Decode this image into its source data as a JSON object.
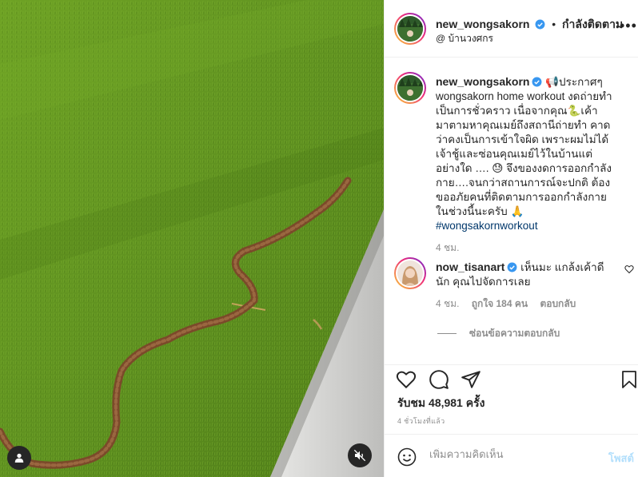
{
  "post": {
    "username": "new_wongsakorn",
    "follow_state": "กำลังติดตาม",
    "location": "บ้านวงศกร",
    "dot": "•"
  },
  "caption": {
    "username": "new_wongsakorn",
    "text": "📢ประกาศๆ wongsakorn home workout งดถ่ายทำเป็นการชั่วคราว เนื่อจากคุณ🐍เค้ามาตามหาคุณเมย์ถึงสถานีถ่ายทำ คาดว่าคงเป็นการเข้าใจผิด เพราะผมไม่ได้เจ้าชู้และซ่อนคุณเมย์ไว้ในบ้านแต่อย่างใด …. 😓 จึงของงดการออกกำลังกาย….จนกว่าสถานการณ์จะปกติ ต้องขออภัยคนที่ติดตามการออกกำลังกายในช่วงนี้นะครับ 🙏",
    "hashtag": "#wongsakornworkout",
    "time": "4 ชม."
  },
  "comment": {
    "username": "now_tisanart",
    "text": "เห็นมะ แกล้งเค้าดีนัก คุณไปจัดการเลย",
    "time": "4 ชม.",
    "likes": "ถูกใจ 184 คน",
    "reply": "ตอบกลับ",
    "hide_replies": "ซ่อนข้อความตอบกลับ"
  },
  "stats": {
    "views": "รับชม 48,981 ครั้ง",
    "time_ago": "4 ชั่วโมงที่แล้ว"
  },
  "composer": {
    "placeholder": "เพิ่มความคิดเห็น",
    "post_label": "โพสต์"
  },
  "colors": {
    "verified": "#3897f0",
    "link": "#00376b",
    "post_disabled": "#b2dffc",
    "grass": "#5e8c1c"
  },
  "icons": [
    "verified-icon",
    "more-icon",
    "heart-icon",
    "comment-icon",
    "share-icon",
    "bookmark-icon",
    "emoji-icon",
    "user-tag-icon",
    "mute-icon"
  ]
}
